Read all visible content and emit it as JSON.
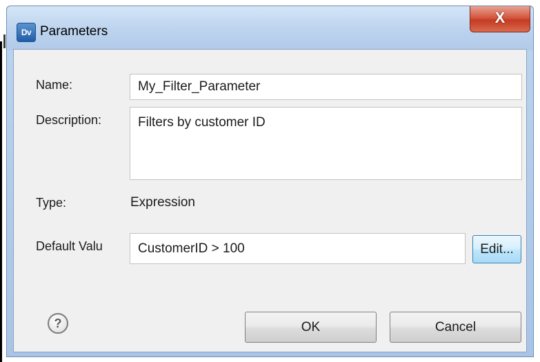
{
  "dialog": {
    "title": "Parameters",
    "app_icon_text": "Dv",
    "close_glyph": "X"
  },
  "form": {
    "name_label": "Name:",
    "name_value": "My_Filter_Parameter",
    "description_label": "Description:",
    "description_value": "Filters by customer ID",
    "type_label": "Type:",
    "type_value": "Expression",
    "default_value_label": "Default Valu",
    "default_value_value": "CustomerID > 100",
    "edit_button_label": "Edit..."
  },
  "footer": {
    "help_glyph": "?",
    "ok_label": "OK",
    "cancel_label": "Cancel"
  },
  "icons": {
    "app": "dv-app-icon",
    "close": "close-icon",
    "help": "help-icon"
  },
  "colors": {
    "titlebar": "#bcd3ee",
    "close_button": "#c43b22",
    "client_background": "#f0f0f0",
    "focused_button": "#bee6fd"
  }
}
